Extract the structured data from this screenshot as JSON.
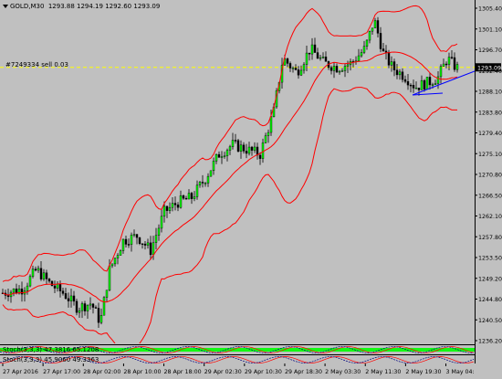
{
  "header": {
    "text": "GOLD,M30  1293.88 1294.19 1292.60 1293.09"
  },
  "order": {
    "label": "#7249334 sell 0.03",
    "price": "1293.09"
  },
  "price_axis": [
    "1305.40",
    "1301.10",
    "1296.70",
    "1292.40",
    "1288.10",
    "1283.80",
    "1279.40",
    "1275.10",
    "1270.80",
    "1266.50",
    "1262.10",
    "1257.80",
    "1253.50",
    "1249.20",
    "1244.80",
    "1240.50",
    "1236.20"
  ],
  "time_axis": [
    "27 Apr 2016",
    "27 Apr 17:00",
    "28 Apr 02:00",
    "28 Apr 10:00",
    "28 Apr 18:00",
    "29 Apr 02:30",
    "29 Apr 10:30",
    "29 Apr 18:30",
    "2 May 03:30",
    "2 May 11:30",
    "2 May 19:30",
    "3 May 04:30"
  ],
  "indicators": [
    {
      "label": "Stoch(3,3,3) 47.3816 65.1208"
    },
    {
      "label": "Stoch(3,3,3) 45.9060 49.3363"
    }
  ],
  "colors": {
    "background": "#c0c0c0",
    "band": "#ff0000",
    "trend": "#0000ff",
    "bull": "#00ff00",
    "bear": "#000000",
    "order_line": "#ffff00"
  }
}
